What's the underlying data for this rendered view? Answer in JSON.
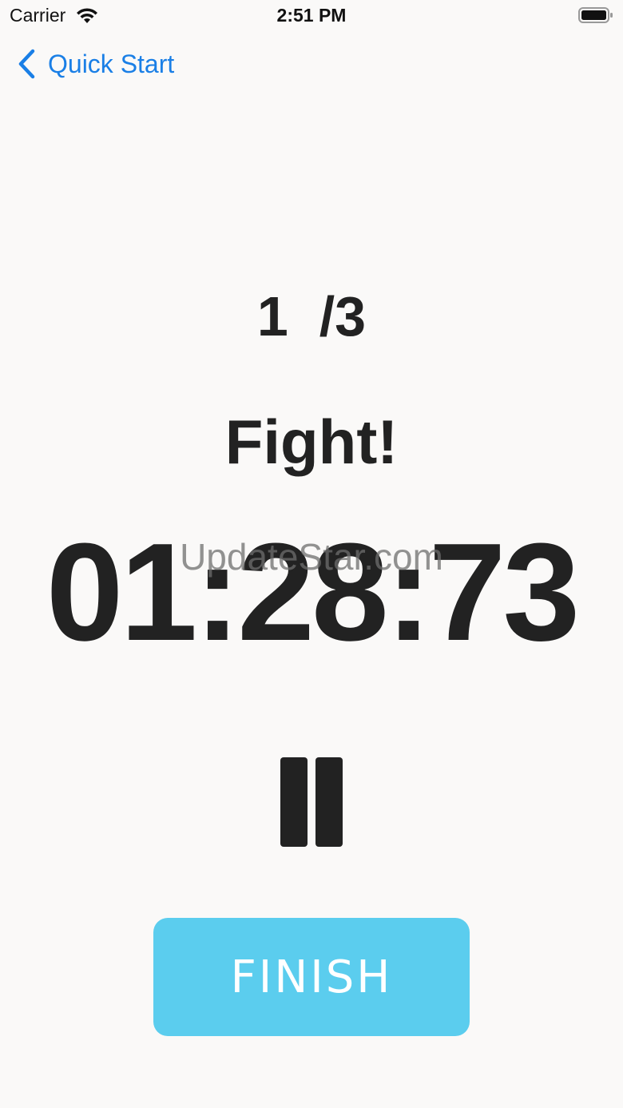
{
  "status_bar": {
    "carrier": "Carrier",
    "time": "2:51 PM",
    "wifi_icon": "wifi-icon",
    "battery_icon": "battery-icon"
  },
  "nav": {
    "back_label": "Quick Start",
    "back_icon": "chevron-left-icon",
    "accent_color": "#1a7fe6"
  },
  "timer_screen": {
    "round_counter": "1  /3",
    "phase": "Fight!",
    "time": "01:28:73",
    "watermark": "UpdateStar.com",
    "pause_icon": "pause-icon",
    "finish_label": "FINISH",
    "finish_color": "#5bcdee"
  }
}
